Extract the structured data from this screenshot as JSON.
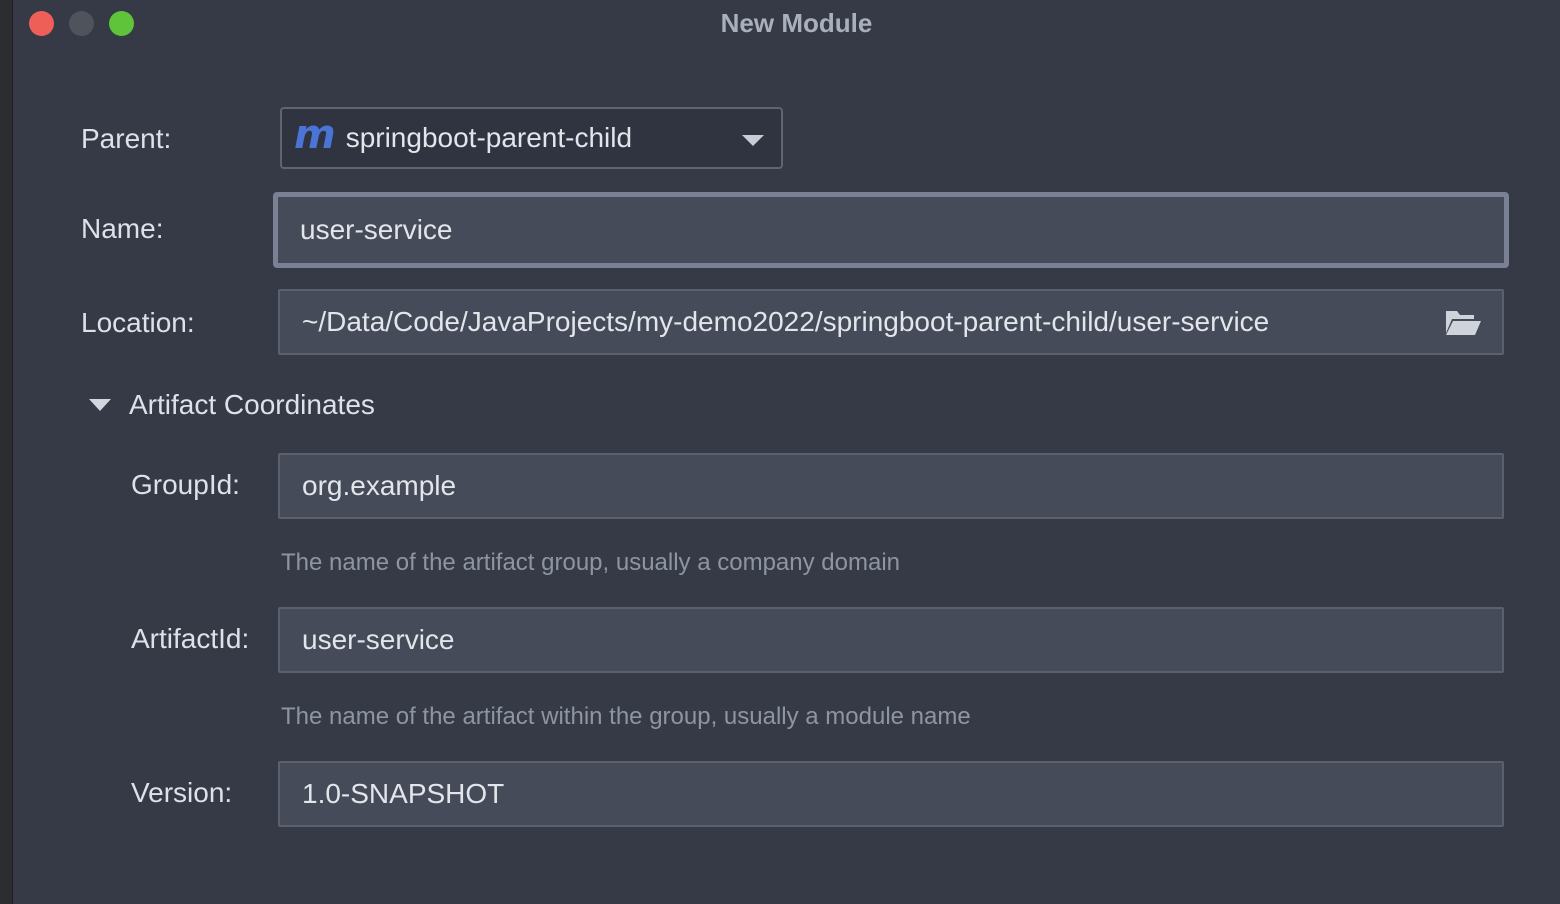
{
  "window": {
    "title": "New Module"
  },
  "parent": {
    "label": "Parent:",
    "icon": "maven-icon",
    "icon_glyph": "m",
    "value": "springboot-parent-child"
  },
  "name": {
    "label": "Name:",
    "value": "user-service"
  },
  "location": {
    "label": "Location:",
    "value": "~/Data/Code/JavaProjects/my-demo2022/springboot-parent-child/user-service",
    "icon": "folder-open-icon"
  },
  "artifact": {
    "section_label": "Artifact Coordinates",
    "group_id": {
      "label": "GroupId:",
      "value": "org.example",
      "hint": "The name of the artifact group, usually a company domain"
    },
    "artifact_id": {
      "label": "ArtifactId:",
      "value": "user-service",
      "hint": "The name of the artifact within the group, usually a module name"
    },
    "version": {
      "label": "Version:",
      "value": "1.0-SNAPSHOT"
    }
  },
  "colors": {
    "background": "#353a46",
    "field_bg": "#454b59",
    "maven_blue": "#4a74d6",
    "close": "#ee5f57",
    "maximize": "#5fc439"
  }
}
